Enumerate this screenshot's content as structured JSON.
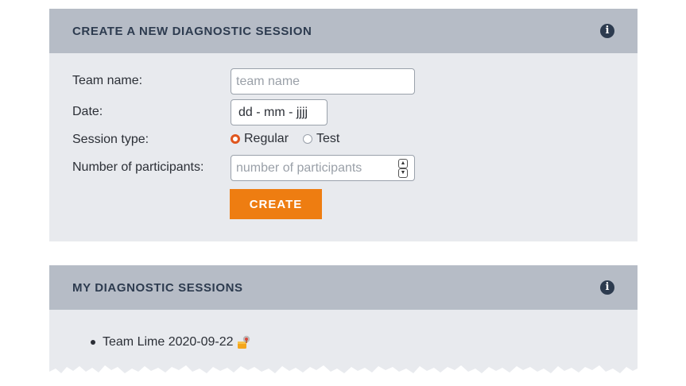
{
  "create_panel": {
    "title": "CREATE A NEW DIAGNOSTIC SESSION",
    "info_icon": "info-icon",
    "fields": {
      "team_name_label": "Team name:",
      "team_name_placeholder": "team name",
      "date_label": "Date:",
      "date_value": "dd - mm - jjjj",
      "session_type_label": "Session type:",
      "session_type_options": [
        "Regular",
        "Test"
      ],
      "session_type_selected": "Regular",
      "participants_label": "Number of participants:",
      "participants_placeholder": "number of participants"
    },
    "create_label": "CREATE"
  },
  "sessions_panel": {
    "title": "MY DIAGNOSTIC SESSIONS",
    "info_icon": "info-icon",
    "items": [
      {
        "label": "Team Lime 2020-09-22",
        "icon": "lock-icon"
      }
    ]
  },
  "colors": {
    "header_bg": "#b6bcc6",
    "panel_bg": "#e8eaee",
    "accent": "#ee7d11",
    "radio_selected": "#e0561e",
    "title_text": "#2d3b4f"
  }
}
